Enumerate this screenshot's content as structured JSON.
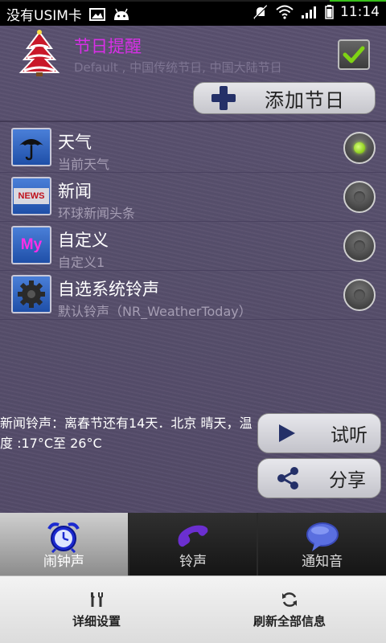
{
  "status_bar": {
    "carrier": "没有USIM卡",
    "time": "11:14",
    "icons": [
      "picture-icon",
      "android-icon",
      "mute-icon",
      "wifi-icon",
      "signal-icon",
      "battery-icon"
    ]
  },
  "header": {
    "title": "节日提醒",
    "subtitle": "Default , 中国传统节日, 中国大陆节日",
    "enabled": true,
    "add_button_label": "添加节日"
  },
  "sound_options": [
    {
      "title": "天气",
      "subtitle": "当前天气",
      "icon": "umbrella-icon",
      "selected": true
    },
    {
      "title": "新闻",
      "subtitle": "环球新闻头条",
      "icon": "news-icon",
      "selected": false
    },
    {
      "title": "自定义",
      "subtitle": "自定义1",
      "icon": "my-icon",
      "selected": false
    },
    {
      "title": "自选系统铃声",
      "subtitle": "默认铃声（NR_WeatherToday）",
      "icon": "gear-icon",
      "selected": false
    }
  ],
  "info_text": "新闻铃声：离春节还有14天．北京 晴天，温度 :17°C至 26°C",
  "actions": {
    "listen_label": "试听",
    "share_label": "分享"
  },
  "tabs": [
    {
      "label": "闹钟声",
      "icon": "alarm-clock-icon",
      "active": true
    },
    {
      "label": "铃声",
      "icon": "phone-icon",
      "active": false
    },
    {
      "label": "通知音",
      "icon": "speech-bubble-icon",
      "active": false
    }
  ],
  "bottom_bar": {
    "settings_label": "详细设置",
    "refresh_label": "刷新全部信息"
  },
  "colors": {
    "title": "#d82fe6",
    "background": "#574f6c",
    "accent_dark": "#243068",
    "radio_on": "#8bcb1a"
  }
}
